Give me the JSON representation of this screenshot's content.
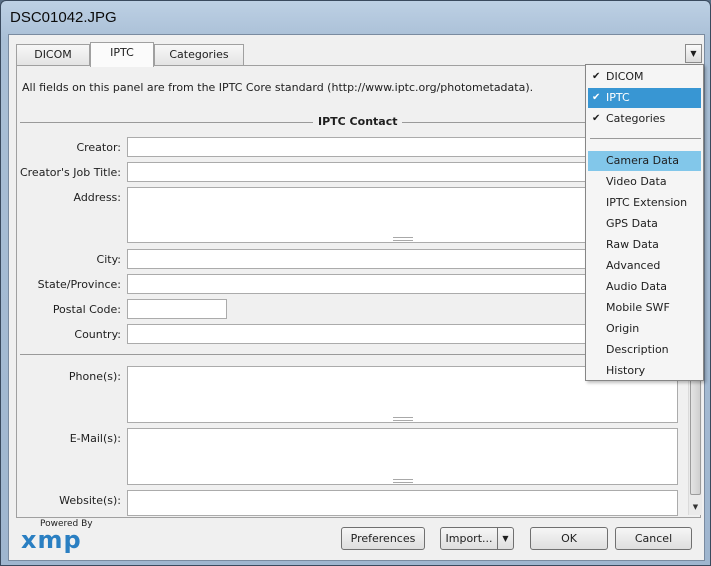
{
  "window": {
    "title": "DSC01042.JPG"
  },
  "tabs": [
    {
      "label": "DICOM"
    },
    {
      "label": "IPTC"
    },
    {
      "label": "Categories"
    }
  ],
  "panel": {
    "note": "All fields on this panel are from the IPTC Core standard (http://www.iptc.org/photometadata).",
    "section_title": "IPTC Contact",
    "fields": {
      "creator": {
        "label": "Creator:",
        "value": ""
      },
      "job_title": {
        "label": "Creator's Job Title:",
        "value": ""
      },
      "address": {
        "label": "Address:",
        "value": ""
      },
      "city": {
        "label": "City:",
        "value": ""
      },
      "state": {
        "label": "State/Province:",
        "value": ""
      },
      "postal": {
        "label": "Postal Code:",
        "value": ""
      },
      "country": {
        "label": "Country:",
        "value": ""
      },
      "phone": {
        "label": "Phone(s):",
        "value": ""
      },
      "email": {
        "label": "E-Mail(s):",
        "value": ""
      },
      "website": {
        "label": "Website(s):",
        "value": ""
      }
    }
  },
  "menu": {
    "checked": [
      {
        "label": "DICOM",
        "checked": true
      },
      {
        "label": "IPTC",
        "checked": true,
        "highlighted": true
      },
      {
        "label": "Categories",
        "checked": true
      }
    ],
    "items": [
      {
        "label": "Camera Data",
        "hover": true
      },
      {
        "label": "Video Data"
      },
      {
        "label": "IPTC Extension"
      },
      {
        "label": "GPS Data"
      },
      {
        "label": "Raw Data"
      },
      {
        "label": "Advanced"
      },
      {
        "label": "Audio Data"
      },
      {
        "label": "Mobile SWF"
      },
      {
        "label": "Origin"
      },
      {
        "label": "Description"
      },
      {
        "label": "History"
      }
    ],
    "checkmark": "✔"
  },
  "footer": {
    "powered_by": "Powered By",
    "logo_text": "xmp",
    "preferences": "Preferences",
    "import": "Import...",
    "ok": "OK",
    "cancel": "Cancel"
  },
  "colors": {
    "menu_highlight": "#3896d3",
    "menu_hover": "#82c7ea",
    "logo_blue": "#2a7fc2"
  }
}
